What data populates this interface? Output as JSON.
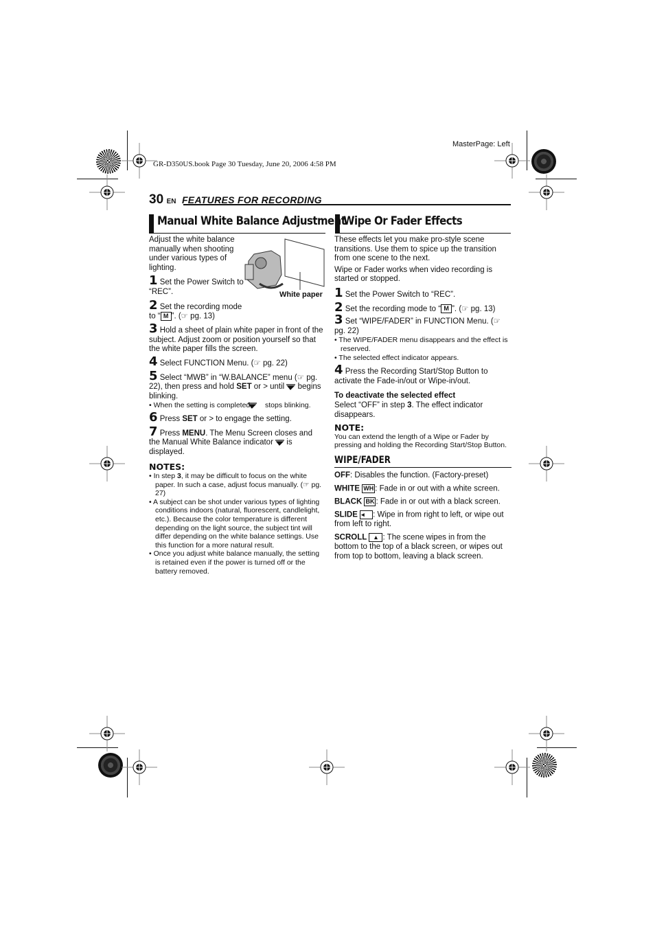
{
  "print_marks": {
    "slug": "GR-D350US.book  Page 30  Tuesday, June 20, 2006  4:58 PM",
    "master_page": "MasterPage: Left"
  },
  "header": {
    "page_number": "30",
    "language": "EN",
    "section_title": "FEATURES FOR RECORDING"
  },
  "left": {
    "title": "Manual White Balance Adjustment",
    "intro": "Adjust the white balance manually when shooting under various types of lighting.",
    "figure_label": "White paper",
    "steps": [
      {
        "num": "1",
        "text": "Set the Power Switch to “REC”."
      },
      {
        "num": "2",
        "text_before": "Set the recording mode to “",
        "icon": "M",
        "text_after": "”. (☞ pg. 13)"
      },
      {
        "num": "3",
        "text": "Hold a sheet of plain white paper in front of the subject. Adjust zoom or position yourself so that the white paper fills the screen."
      },
      {
        "num": "4",
        "text": "Select FUNCTION Menu. (☞ pg. 22)"
      },
      {
        "num": "5",
        "text_a": "Select “MWB” in “W.BALANCE” menu (☞ pg. 22), then press and hold ",
        "bold": "SET",
        "text_b": " or > until ",
        "text_c": " begins blinking."
      },
      {
        "num": "6",
        "text_a": "Press ",
        "bold": "SET",
        "text_b": " or > to engage the setting."
      },
      {
        "num": "7",
        "text_a": "Press ",
        "bold": "MENU",
        "text_b": ". The Menu Screen closes and the Manual White Balance indicator ",
        "text_c": " is displayed."
      }
    ],
    "step5_bullet_a": "When the setting is completed, ",
    "step5_bullet_b": " stops blinking.",
    "notes_heading": "NOTES:",
    "notes": [
      {
        "a": "In step ",
        "b": "3",
        "c": ", it may be difficult to focus on the white paper. In such a case, adjust focus manually. (☞ pg. 27)"
      },
      {
        "a": "A subject can be shot under various types of lighting conditions indoors (natural, fluorescent, candlelight, etc.). Because the color temperature is different depending on the light source, the subject tint will differ depending on the white balance settings. Use this function for a more natural result."
      },
      {
        "a": "Once you adjust white balance manually, the setting is retained even if the power is turned off or the battery removed."
      }
    ]
  },
  "right": {
    "title": "Wipe Or Fader Effects",
    "intro1": "These effects let you make pro-style scene transitions. Use them to spice up the transition from one scene to the next.",
    "intro2": "Wipe or Fader works when video recording is started or stopped.",
    "steps": [
      {
        "num": "1",
        "text": "Set the Power Switch to “REC”."
      },
      {
        "num": "2",
        "text_before": "Set the recording mode to “",
        "icon": "M",
        "text_after": "”. (☞ pg. 13)"
      },
      {
        "num": "3",
        "text": "Set “WIPE/FADER” in FUNCTION Menu. (☞ pg. 22)"
      },
      {
        "num": "4",
        "text": "Press the Recording Start/Stop Button to activate the Fade-in/out or Wipe-in/out."
      }
    ],
    "step3_bullets": [
      "The WIPE/FADER menu disappears and the effect is reserved.",
      "The selected effect indicator appears."
    ],
    "deactivate_heading": "To deactivate the selected effect",
    "deactivate_a": "Select “OFF” in step ",
    "deactivate_b": "3",
    "deactivate_c": ". The effect indicator disappears.",
    "note_heading": "NOTE:",
    "note": "You can extend the length of a Wipe or Fader by pressing and holding the Recording Start/Stop Button.",
    "sub_title": "WIPE/FADER",
    "options": [
      {
        "name": "OFF",
        "icon": "",
        "desc": ": Disables the function. (Factory-preset)"
      },
      {
        "name": "WHITE",
        "icon": "WH",
        "desc": ": Fade in or out with a white screen."
      },
      {
        "name": "BLACK",
        "icon": "BK",
        "desc": ": Fade in or out with a black screen."
      },
      {
        "name": "SLIDE",
        "icon": "◂",
        "desc": ": Wipe in from right to left, or wipe out from left to right."
      },
      {
        "name": "SCROLL",
        "icon": "▴",
        "desc": ": The scene wipes in from the bottom to the top of a black screen, or wipes out from top to bottom, leaving a black screen."
      }
    ]
  }
}
